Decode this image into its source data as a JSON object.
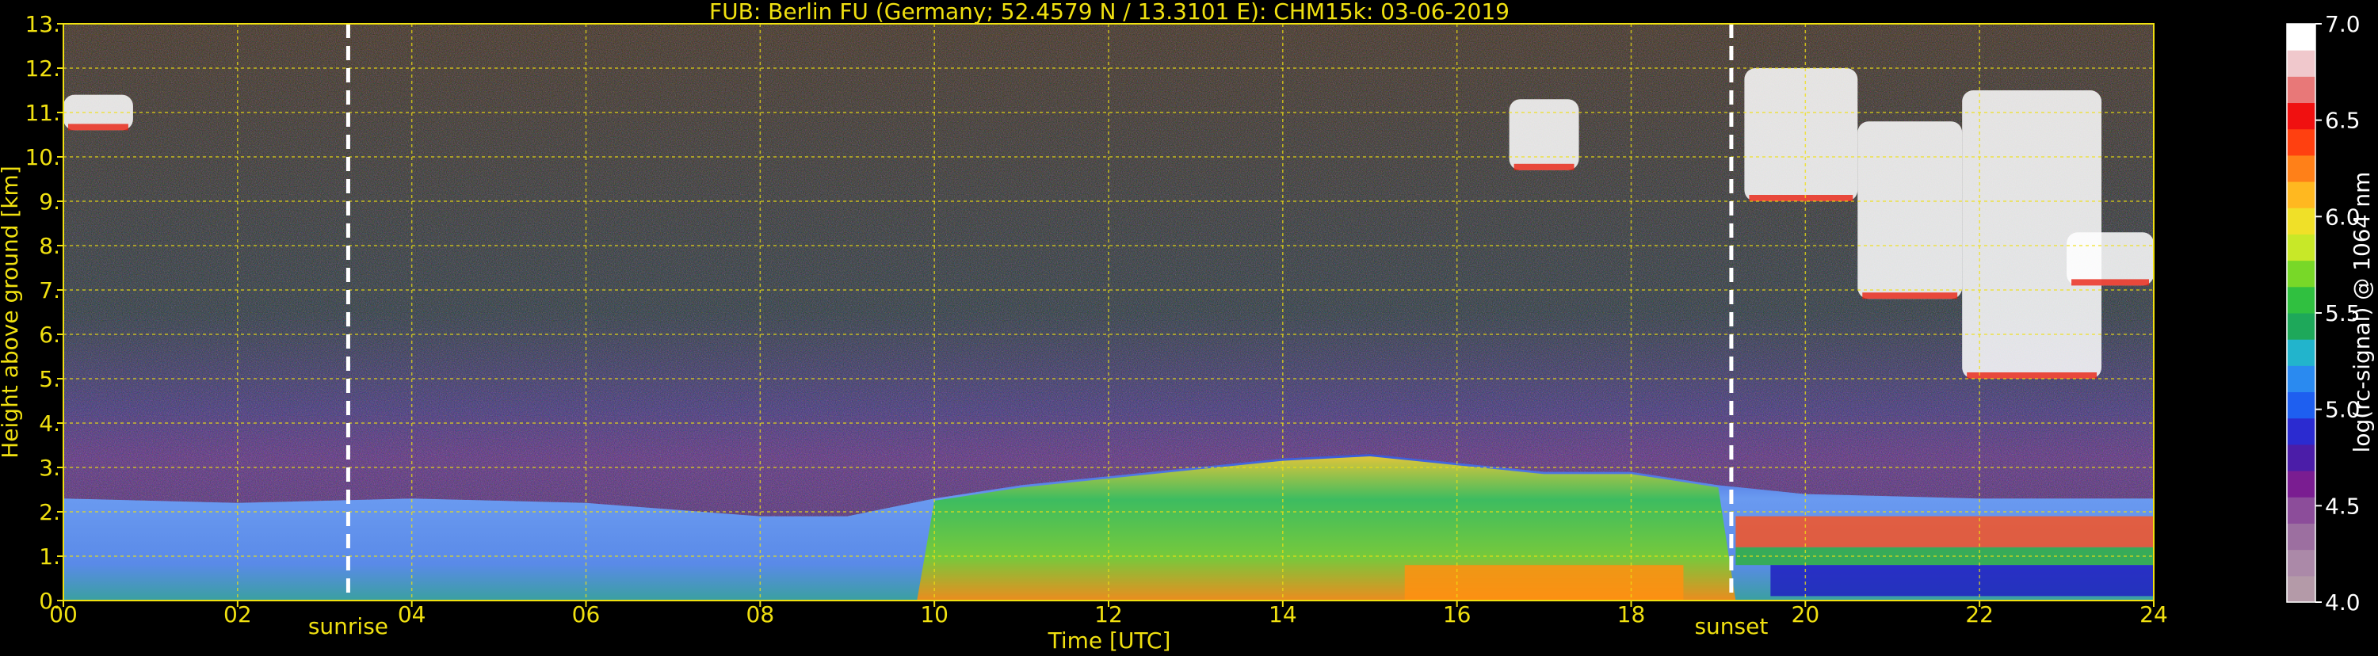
{
  "chart_data": {
    "type": "heatmap",
    "title": "FUB: Berlin FU (Germany; 52.4579 N / 13.3101 E):    CHM15k: 03-06-2019",
    "xlabel": "Time [UTC]",
    "ylabel": "Height above ground [km]",
    "colorbar_label": "log(rc-signal) @ 1064 nm",
    "xlim": [
      0,
      24
    ],
    "ylim": [
      0,
      13
    ],
    "clim": [
      4.0,
      7.0
    ],
    "x_ticks": [
      "00",
      "02",
      "04",
      "06",
      "08",
      "10",
      "12",
      "14",
      "16",
      "18",
      "20",
      "22",
      "24"
    ],
    "y_ticks": [
      "0.",
      "1.",
      "2.",
      "3.",
      "4.",
      "5.",
      "6.",
      "7.",
      "8.",
      "9.",
      "10.",
      "11.",
      "12.",
      "13."
    ],
    "colorbar_ticks": [
      "4.0",
      "4.5",
      "5.0",
      "5.5",
      "6.0",
      "6.5",
      "7.0"
    ],
    "grid": true,
    "markers": [
      {
        "label": "sunrise",
        "time": 3.27
      },
      {
        "label": "sunset",
        "time": 19.15
      }
    ],
    "colormap": [
      "#b49aa8",
      "#ab89a8",
      "#9c6fa0",
      "#8c4d9a",
      "#7a1d91",
      "#4b1da8",
      "#2b2bd0",
      "#1e5ff0",
      "#2a8af0",
      "#22b4cc",
      "#1ea85a",
      "#30c040",
      "#78d828",
      "#c8e828",
      "#f0e028",
      "#ffb820",
      "#ff8018",
      "#ff4010",
      "#f01010",
      "#e87878",
      "#f0c8cc",
      "#ffffff"
    ],
    "layers": {
      "boundary_layer_top_km": [
        [
          0,
          2.3
        ],
        [
          2,
          2.2
        ],
        [
          4,
          2.3
        ],
        [
          6,
          2.2
        ],
        [
          8,
          1.9
        ],
        [
          9,
          1.9
        ],
        [
          10,
          2.3
        ],
        [
          11,
          2.6
        ],
        [
          12,
          2.8
        ],
        [
          14,
          3.2
        ],
        [
          15,
          3.3
        ],
        [
          16,
          3.1
        ],
        [
          17,
          2.9
        ],
        [
          18,
          2.9
        ],
        [
          19,
          2.6
        ],
        [
          20,
          2.4
        ],
        [
          22,
          2.3
        ],
        [
          24,
          2.3
        ]
      ],
      "cloud_segments": [
        {
          "time": [
            0.0,
            0.8
          ],
          "height_km": [
            10.6,
            11.4
          ]
        },
        {
          "time": [
            16.6,
            17.4
          ],
          "height_km": [
            9.7,
            11.3
          ]
        },
        {
          "time": [
            19.3,
            20.6
          ],
          "height_km": [
            9.0,
            12.0
          ]
        },
        {
          "time": [
            20.6,
            21.8
          ],
          "height_km": [
            6.8,
            10.8
          ]
        },
        {
          "time": [
            21.8,
            23.4
          ],
          "height_km": [
            5.0,
            11.5
          ]
        },
        {
          "time": [
            23.0,
            24.0
          ],
          "height_km": [
            7.1,
            8.3
          ]
        }
      ]
    }
  }
}
